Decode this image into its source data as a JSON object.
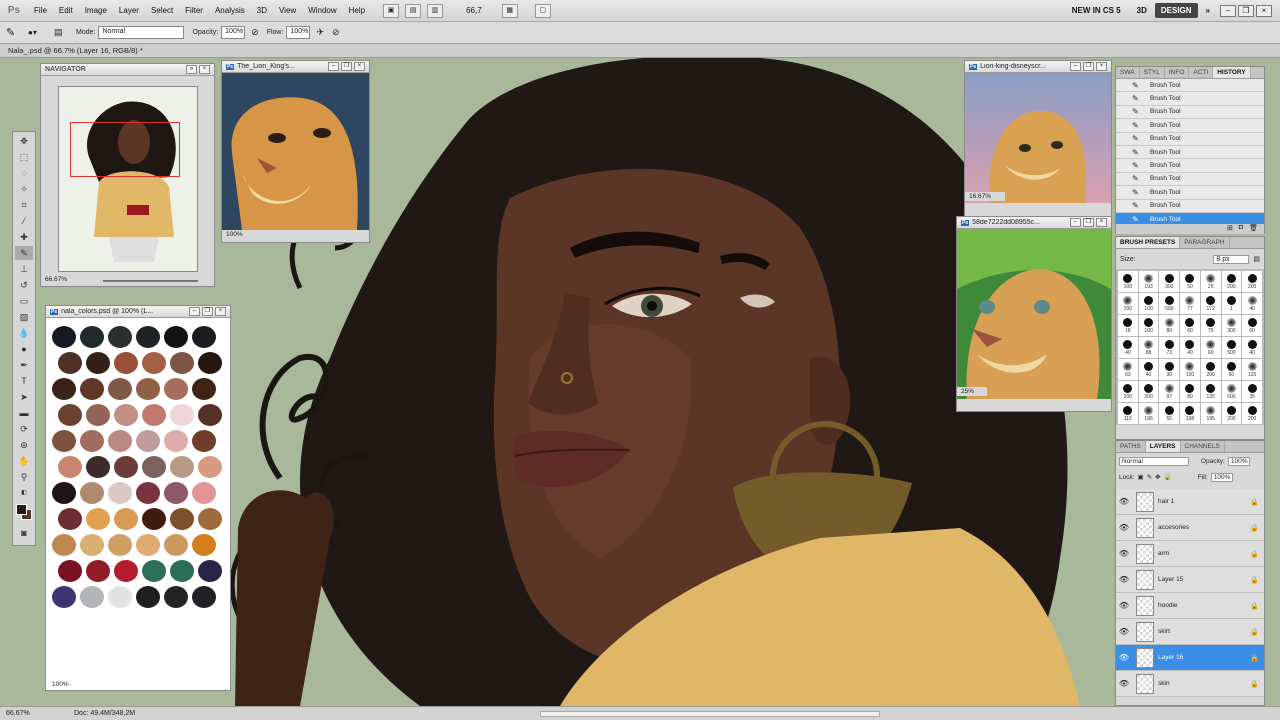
{
  "app": {
    "logo": "Ps"
  },
  "menu": [
    "File",
    "Edit",
    "Image",
    "Layer",
    "Select",
    "Filter",
    "Analysis",
    "3D",
    "View",
    "Window",
    "Help"
  ],
  "menubar_zoom": "66,7",
  "workspaces": {
    "new_in": "NEW IN CS 5",
    "three_d": "3D",
    "design": "DESIGN",
    "more": "»"
  },
  "options": {
    "mode_label": "Mode:",
    "mode_value": "Normal",
    "opacity_label": "Opacity:",
    "opacity_value": "100%",
    "flow_label": "Flow:",
    "flow_value": "100%"
  },
  "document": {
    "tab_title": "Nala_.psd @ 66.7% (Layer 16, RGB/8) *"
  },
  "status": {
    "zoom": "66.67%",
    "doc": "Doc: 49,4M/348,2M"
  },
  "navigator": {
    "title": "NAVIGATOR",
    "zoom": "66.67%"
  },
  "ref_windows": [
    {
      "title": "The_Lion_King's...",
      "zoom": "100%"
    },
    {
      "title": "Lion-king-disneyscr...",
      "zoom": "16.67%"
    },
    {
      "title": "58de7222dd08955c...",
      "zoom": "25%"
    }
  ],
  "colors_window": {
    "title": "nala_colors.psd @ 100% (L...",
    "zoom": "100%"
  },
  "history": {
    "tabs": [
      "SWA",
      "STYL",
      "INFO",
      "ACTI",
      "HISTORY"
    ],
    "items": [
      "Brush Tool",
      "Brush Tool",
      "Brush Tool",
      "Brush Tool",
      "Brush Tool",
      "Brush Tool",
      "Brush Tool",
      "Brush Tool",
      "Brush Tool",
      "Brush Tool",
      "Brush Tool"
    ],
    "selected_index": 10
  },
  "brush_presets": {
    "tabs": [
      "BRUSH PRESETS",
      "PARAGRAPH"
    ],
    "size_label": "Size:",
    "size_value": "8 px",
    "sizes": [
      "100",
      "193",
      "300",
      "50",
      "25",
      "200",
      "200",
      "200",
      "100",
      "500",
      "77",
      "172",
      "1",
      "40",
      "18",
      "100",
      "80",
      "60",
      "75",
      "300",
      "60",
      "40",
      "88",
      "73",
      "40",
      "60",
      "500",
      "40",
      "63",
      "40",
      "30",
      "100",
      "200",
      "60",
      "125",
      "200",
      "200",
      "97",
      "80",
      "135",
      "500",
      "35",
      "115",
      "196",
      "55",
      "138",
      "195",
      "200",
      "200"
    ]
  },
  "layers": {
    "tabs": [
      "PATHS",
      "LAYERS",
      "CHANNELS"
    ],
    "blend_mode": "Normal",
    "opacity_label": "Opacity:",
    "opacity_value": "100%",
    "lock_label": "Lock:",
    "fill_label": "Fill:",
    "fill_value": "100%",
    "items": [
      "hair 1",
      "accesories",
      "arm",
      "Layer 15",
      "hoodie",
      "skirt",
      "Layer 16",
      "skin"
    ],
    "selected_index": 6
  },
  "palette_colors": [
    "#151b20",
    "#202a2c",
    "#2b302e",
    "#1f2325",
    "#111417",
    "#1b1d20",
    "#4f3026",
    "#332018",
    "#9b5137",
    "#a45f47",
    "#7e5443",
    "#251612",
    "#3b2218",
    "#5f3828",
    "#7f5846",
    "#915e46",
    "#a76e5e",
    "#3f2216",
    "#6b4131",
    "#946358",
    "#c28f85",
    "#c17b6f",
    "#efd7d8",
    "#563127",
    "#7d5340",
    "#a26c5f",
    "#b98a82",
    "#c09ea0",
    "#dfaba8",
    "#6f3e2a",
    "#c88670",
    "#3b2b2b",
    "#6b3c3a",
    "#7c625c",
    "#b99a87",
    "#d99b80",
    "#1d1418",
    "#b08a70",
    "#d9c7c1",
    "#7b3342",
    "#8d5968",
    "#e49598",
    "#6e2e31",
    "#e2a151",
    "#d79c51",
    "#3f1c0d",
    "#7f4f2a",
    "#9d6b3c",
    "#c0874e",
    "#d9b072",
    "#cfa063",
    "#e2aa73",
    "#cb9a61",
    "#d47e1c",
    "#7a1120",
    "#8f1d28",
    "#b51c2c",
    "#2b6f57",
    "#2c6d56",
    "#272448",
    "#3d3670",
    "#b2b5b7",
    "#e1e3e1",
    "#1e1f21",
    "#232426",
    "#212226"
  ],
  "accent": "#3a8ee6"
}
